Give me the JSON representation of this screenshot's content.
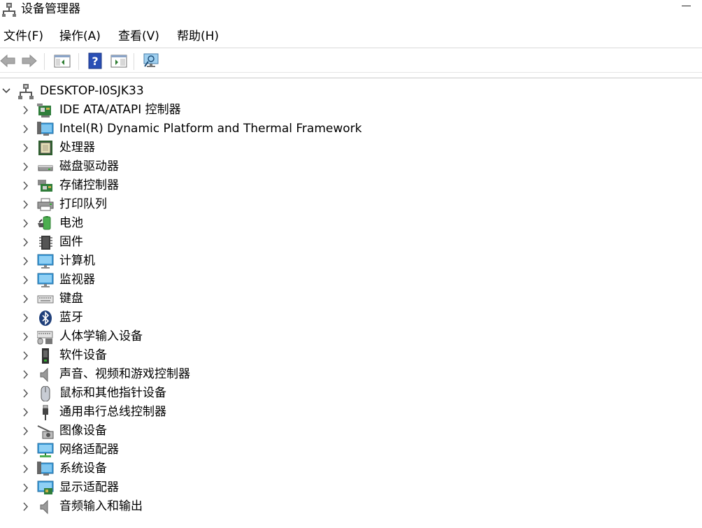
{
  "window": {
    "title": "设备管理器",
    "icon": "device-manager-icon"
  },
  "menu": [
    "文件(F)",
    "操作(A)",
    "查看(V)",
    "帮助(H)"
  ],
  "toolbar": {
    "buttons": [
      "back-icon",
      "forward-icon",
      "show-hide-console-tree-icon",
      "help-icon",
      "properties-icon",
      "scan-hardware-icon"
    ]
  },
  "tree": {
    "root": {
      "label": "DESKTOP-I0SJK33",
      "expanded": true,
      "icon": "computer-root-icon"
    },
    "items": [
      {
        "label": "IDE ATA/ATAPI 控制器",
        "icon": "ide-controller-icon"
      },
      {
        "label": "Intel(R) Dynamic Platform and Thermal Framework",
        "icon": "system-device-icon"
      },
      {
        "label": "处理器",
        "icon": "processor-icon"
      },
      {
        "label": "磁盘驱动器",
        "icon": "disk-drive-icon"
      },
      {
        "label": "存储控制器",
        "icon": "storage-controller-icon"
      },
      {
        "label": "打印队列",
        "icon": "printer-icon"
      },
      {
        "label": "电池",
        "icon": "battery-icon"
      },
      {
        "label": "固件",
        "icon": "firmware-icon"
      },
      {
        "label": "计算机",
        "icon": "computer-icon"
      },
      {
        "label": "监视器",
        "icon": "monitor-icon"
      },
      {
        "label": "键盘",
        "icon": "keyboard-icon"
      },
      {
        "label": "蓝牙",
        "icon": "bluetooth-icon"
      },
      {
        "label": "人体学输入设备",
        "icon": "hid-icon"
      },
      {
        "label": "软件设备",
        "icon": "software-device-icon"
      },
      {
        "label": "声音、视频和游戏控制器",
        "icon": "sound-icon"
      },
      {
        "label": "鼠标和其他指针设备",
        "icon": "mouse-icon"
      },
      {
        "label": "通用串行总线控制器",
        "icon": "usb-icon"
      },
      {
        "label": "图像设备",
        "icon": "camera-icon"
      },
      {
        "label": "网络适配器",
        "icon": "network-adapter-icon"
      },
      {
        "label": "系统设备",
        "icon": "system-device-icon"
      },
      {
        "label": "显示适配器",
        "icon": "display-adapter-icon"
      },
      {
        "label": "音频输入和输出",
        "icon": "audio-io-icon"
      }
    ]
  }
}
